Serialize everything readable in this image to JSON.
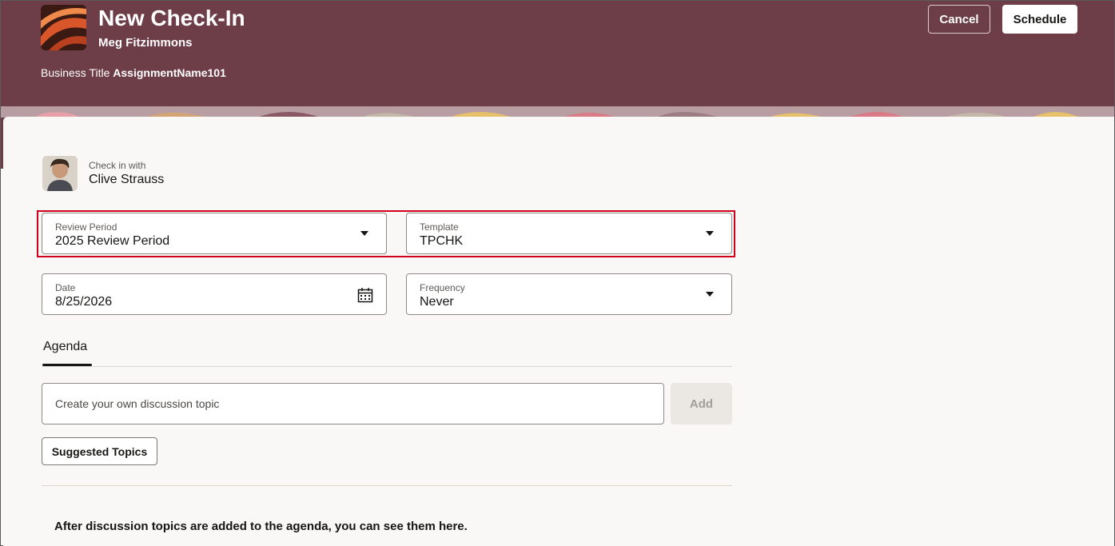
{
  "header": {
    "title": "New Check-In",
    "person_name": "Meg Fitzimmons",
    "business_title_label": "Business Title",
    "business_title_value": "AssignmentName101",
    "cancel_label": "Cancel",
    "schedule_label": "Schedule"
  },
  "checkin": {
    "label": "Check in with",
    "name": "Clive Strauss"
  },
  "form": {
    "review_period": {
      "label": "Review Period",
      "value": "2025 Review Period"
    },
    "template": {
      "label": "Template",
      "value": "TPCHK"
    },
    "date": {
      "label": "Date",
      "value": "8/25/2026"
    },
    "frequency": {
      "label": "Frequency",
      "value": "Never"
    }
  },
  "agenda": {
    "tab_label": "Agenda",
    "topic_placeholder": "Create your own discussion topic",
    "add_label": "Add",
    "suggested_label": "Suggested Topics",
    "empty_message": "After discussion topics are added to the agenda, you can see them here."
  },
  "colors": {
    "header_bg": "#6e3e48",
    "highlight": "#d0021b"
  }
}
